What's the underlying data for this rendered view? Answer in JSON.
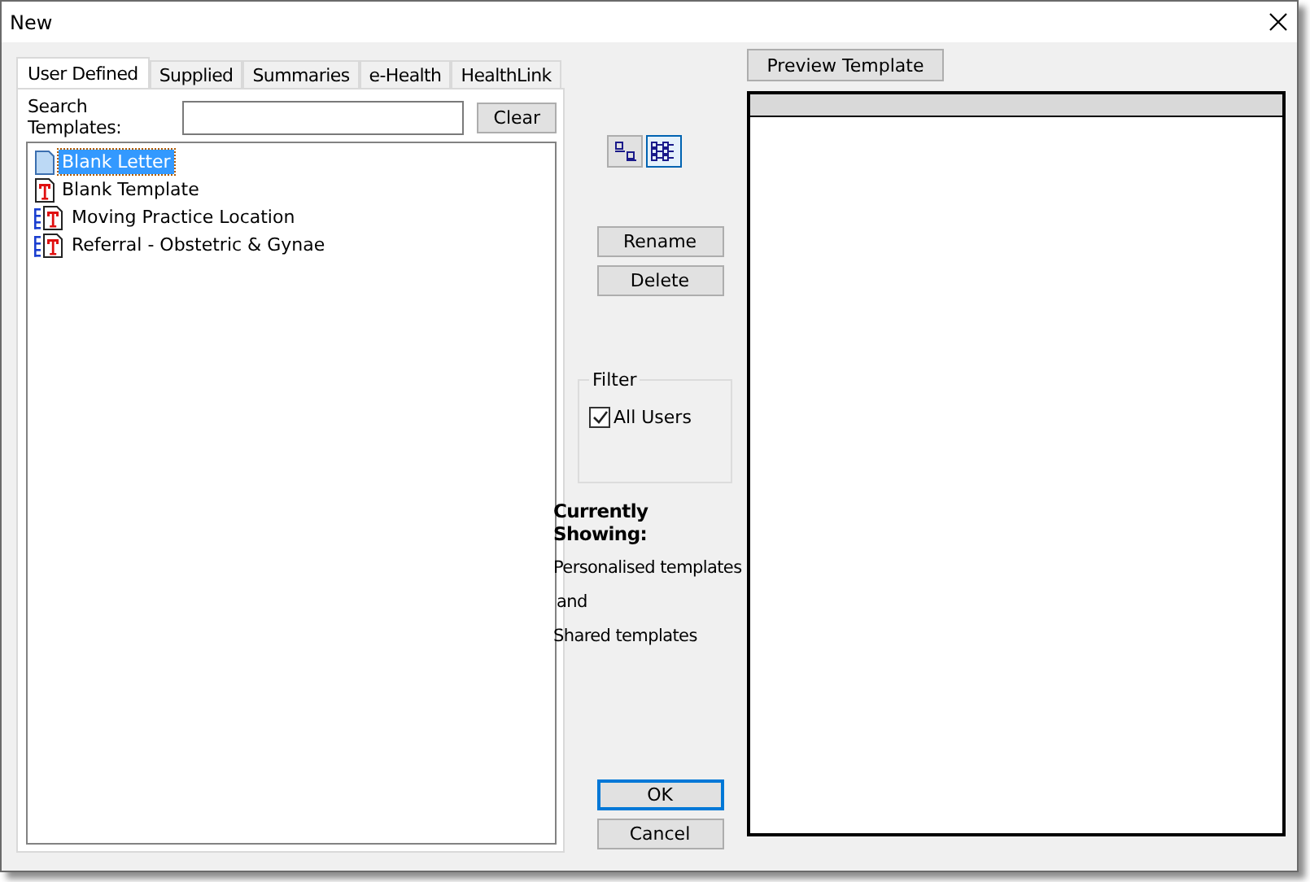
{
  "window": {
    "title": "New"
  },
  "tabs": [
    {
      "label": "User Defined",
      "selected": true
    },
    {
      "label": "Supplied",
      "selected": false
    },
    {
      "label": "Summaries",
      "selected": false
    },
    {
      "label": "e-Health",
      "selected": false
    },
    {
      "label": "HealthLink",
      "selected": false
    }
  ],
  "search": {
    "label": "Search Templates:",
    "clear_button": "Clear"
  },
  "templates": [
    {
      "name": "Blank Letter",
      "kind": "letter",
      "selected": true
    },
    {
      "name": "Blank Template",
      "kind": "template",
      "selected": false
    },
    {
      "name": "Moving Practice Location",
      "kind": "shared",
      "selected": false
    },
    {
      "name": "Referral - Obstetric & Gynae",
      "kind": "shared",
      "selected": false
    }
  ],
  "view_buttons": [
    {
      "kind": "icons",
      "selected": false
    },
    {
      "kind": "list",
      "selected": true
    }
  ],
  "buttons": {
    "rename": "Rename",
    "delete": "Delete",
    "ok": "OK",
    "cancel": "Cancel",
    "preview": "Preview Template"
  },
  "filter": {
    "title": "Filter",
    "label": "All Users",
    "checked": true
  },
  "currently_showing": {
    "heading": "Currently Showing:",
    "lines": [
      "Personalised templates",
      "and",
      "Shared templates"
    ]
  }
}
